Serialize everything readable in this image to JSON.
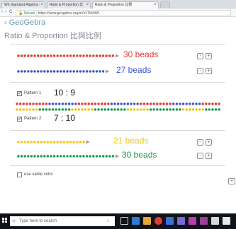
{
  "browser": {
    "tabs": [
      {
        "label": "Wh Standard Algebra -"
      },
      {
        "label": "Ratio & Proportion 比"
      },
      {
        "label": "Ratio & Proportion 比例"
      }
    ],
    "nav": {
      "back": "‹",
      "forward": "›",
      "reload": "C"
    },
    "address": {
      "secure": "Secure",
      "url": "https://www.geogebra.org/m/VcTkk6tW"
    }
  },
  "page": {
    "brand": "GeoGebra",
    "title": "Ratio & Proportion 比與比例"
  },
  "rows1": [
    {
      "text": "30 beads",
      "color": "#e23b2f",
      "bead_color": "#e23b2f",
      "count": 30
    },
    {
      "text": "27 beads",
      "color": "#3d55c8",
      "bead_color": "#3d55c8",
      "count": 27
    }
  ],
  "pattern1": {
    "label": "Pattern 1",
    "ratio": "10 : 9",
    "checked": "✓"
  },
  "pattern2": {
    "label": "Pattern 2",
    "ratio": "7 : 10",
    "checked": "✓"
  },
  "rows2": [
    {
      "text": "21 beads",
      "color": "#f1c51b",
      "bead_color": "#f1c51b",
      "count": 21
    },
    {
      "text": "30 beads",
      "color": "#1c9a4a",
      "bead_color": "#1c9a4a",
      "count": 30
    }
  ],
  "use_same_color": {
    "label": "use same color"
  },
  "controls": {
    "minus": "-",
    "plus": "+"
  },
  "taskbar": {
    "search_placeholder": "Type here to search"
  }
}
